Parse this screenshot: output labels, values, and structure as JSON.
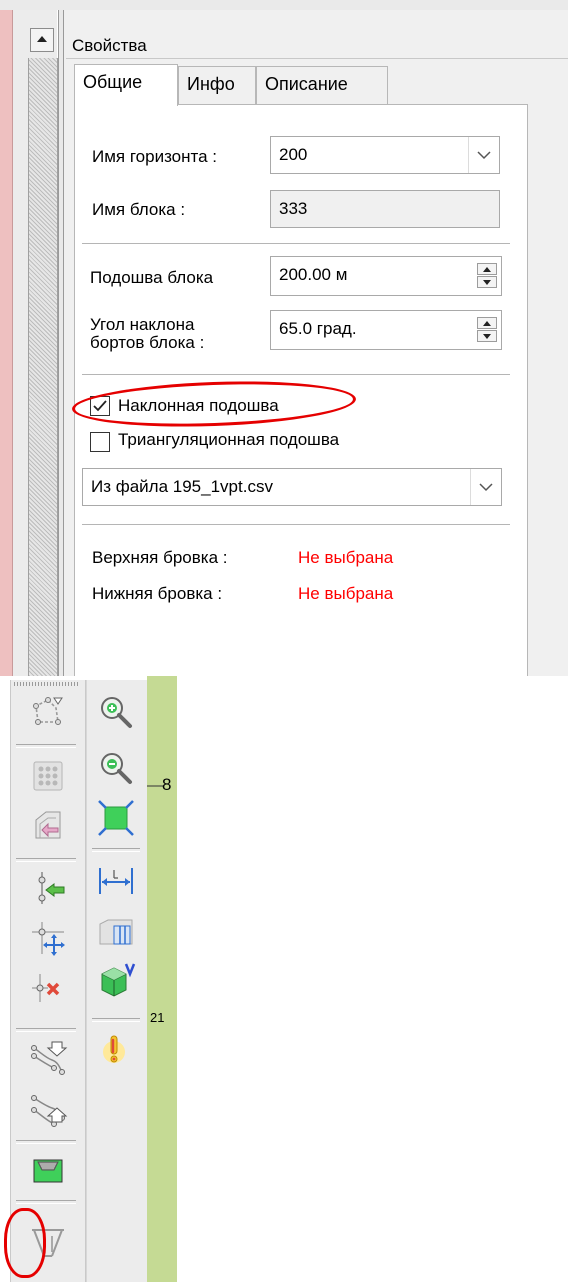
{
  "panel": {
    "title": "Свойства",
    "tabs": [
      {
        "label": "Общие",
        "active": true
      },
      {
        "label": "Инфо",
        "active": false
      },
      {
        "label": "Описание",
        "active": false
      }
    ]
  },
  "general": {
    "horizon_label": "Имя горизонта :",
    "horizon_value": "200",
    "block_name_label": "Имя блока :",
    "block_name_value": "333",
    "block_base_label": "Подошва блока",
    "block_base_value": "200.00 м",
    "slope_label_line1": "Угол наклона",
    "slope_label_line2": "бортов блока :",
    "slope_value": "65.0 град.",
    "inclined_base_label": "Наклонная подошва",
    "inclined_base_checked": true,
    "triangulation_base_label": "Триангуляционная  подошва",
    "triangulation_base_checked": false,
    "source_value": "Из файла 195_1vpt.csv",
    "upper_edge_label": "Верхняя бровка :",
    "upper_edge_value": "Не выбрана",
    "lower_edge_label": "Нижняя бровка :",
    "lower_edge_value": "Не выбрана"
  },
  "canvas": {
    "label_8": "8",
    "label_21": "21"
  },
  "colors": {
    "annotation_red": "#e50000",
    "status_red": "#ff0000",
    "canvas_green": "#c5da94"
  },
  "toolbar_left_icons": [
    "polygon-select-icon",
    "point-grid-icon",
    "import-block-icon",
    "add-point-icon",
    "move-point-icon",
    "delete-point-icon",
    "line-down-icon",
    "line-up-icon",
    "fill-area-icon",
    "slope-base-icon"
  ],
  "toolbar_right_icons": [
    "zoom-in-icon",
    "zoom-out-icon",
    "zoom-extents-icon",
    "measure-distance-icon",
    "section-icon",
    "volume-icon",
    "warning-icon"
  ]
}
